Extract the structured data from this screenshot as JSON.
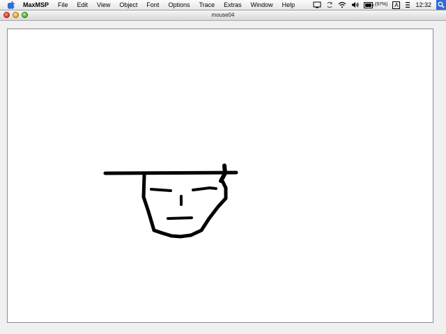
{
  "menubar": {
    "app_name": "MaxMSP",
    "menus": [
      "File",
      "Edit",
      "View",
      "Object",
      "Font",
      "Options",
      "Trace",
      "Extras",
      "Window",
      "Help"
    ],
    "battery_text": "(97%)",
    "input_menu": "A",
    "clock": "12:32",
    "icons": [
      "apple-icon",
      "display-icon",
      "sync-icon",
      "wifi-icon",
      "volume-icon",
      "battery-icon",
      "input-menu-icon",
      "clock-icon",
      "spotlight-icon"
    ]
  },
  "window": {
    "title": "mouse04"
  },
  "drawing": {
    "color": "#000000",
    "description_strokes": [
      "hat-brim",
      "hat-post",
      "face-outline",
      "left-eyebrow",
      "right-eyebrow",
      "nose",
      "mouth"
    ]
  }
}
